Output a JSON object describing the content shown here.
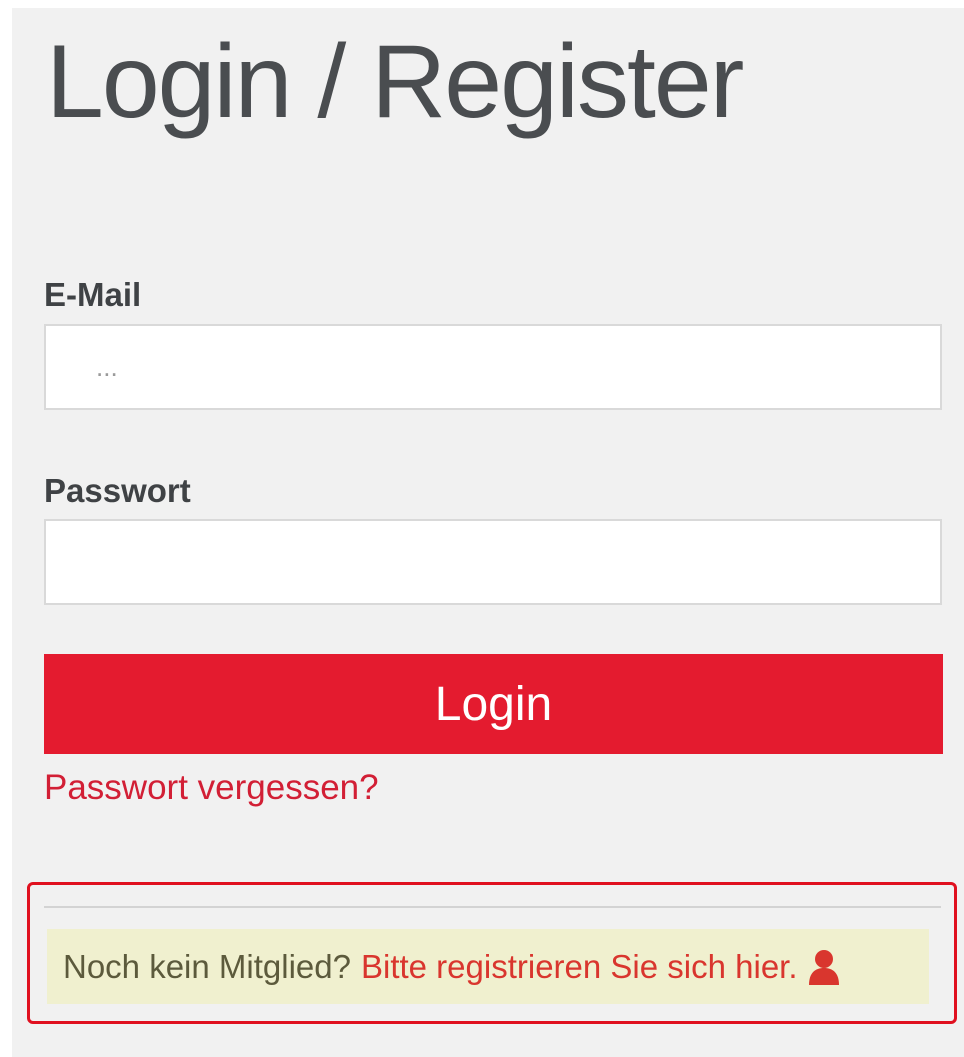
{
  "header": {
    "title": "Login / Register"
  },
  "form": {
    "email_label": "E-Mail",
    "email_placeholder": "...",
    "email_value": "",
    "password_label": "Passwort",
    "password_value": "",
    "login_button_label": "Login",
    "forgot_password_link": "Passwort vergessen?"
  },
  "register": {
    "question": "Noch kein Mitglied?",
    "link_text": "Bitte registrieren Sie sich hier.",
    "icon": "user-icon"
  },
  "colors": {
    "accent": "#e41b2f",
    "link": "#d21f35",
    "register_link": "#d9362e",
    "highlight_outline": "#e0101f",
    "register_background": "#f0f0cf",
    "panel_background": "#f1f1f1"
  }
}
